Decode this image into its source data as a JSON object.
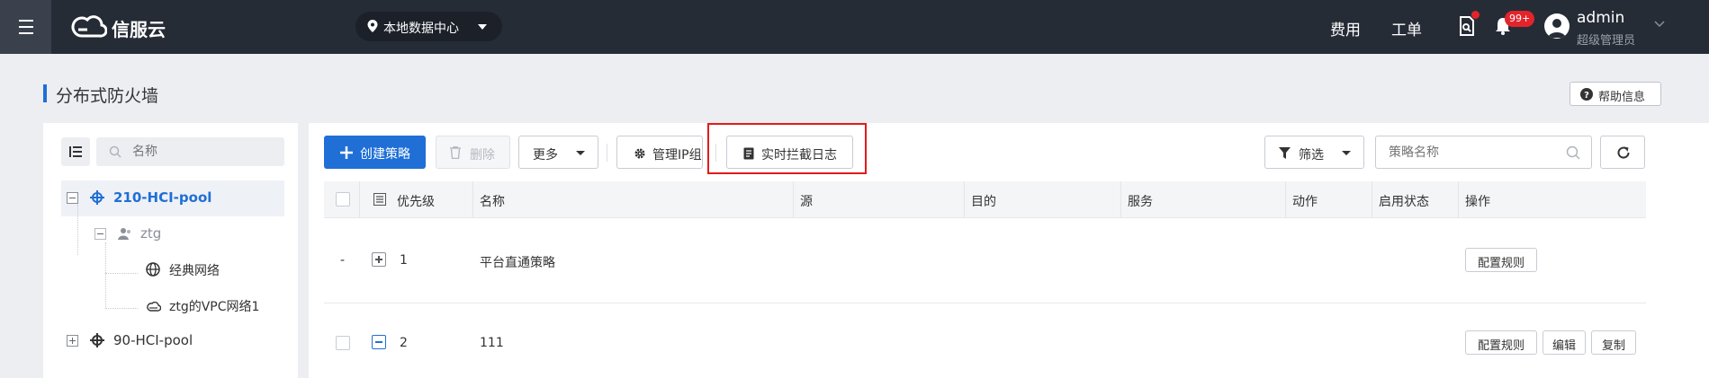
{
  "app": {
    "brand": "信服云",
    "datacenter": "本地数据中心",
    "links": {
      "billing": "费用",
      "tickets": "工单"
    },
    "notifications_badge": "99+",
    "user": {
      "name": "admin",
      "role": "超级管理员"
    }
  },
  "page": {
    "title": "分布式防火墙",
    "help_label": "帮助信息"
  },
  "tree": {
    "search_placeholder": "名称",
    "nodes": [
      {
        "label": "210-HCI-pool",
        "selected": true,
        "expanded": true
      },
      {
        "label": "ztg",
        "expanded": true
      },
      {
        "label": "经典网络"
      },
      {
        "label": "ztg的VPC网络1"
      },
      {
        "label": "90-HCI-pool",
        "expanded": false
      }
    ]
  },
  "toolbar": {
    "create": "创建策略",
    "delete": "删除",
    "more": "更多",
    "manage_ip_group": "管理IP组",
    "realtime_log": "实时拦截日志",
    "filter": "筛选",
    "search_placeholder": "策略名称"
  },
  "table": {
    "columns": [
      "优先级",
      "名称",
      "源",
      "目的",
      "服务",
      "动作",
      "启用状态",
      "操作"
    ],
    "rows": [
      {
        "check": "-",
        "priority": "1",
        "name": "平台直通策略",
        "actions": [
          "配置规则"
        ]
      },
      {
        "check": "",
        "priority": "2",
        "name": "111",
        "actions": [
          "配置规则",
          "编辑",
          "复制"
        ]
      }
    ]
  },
  "colors": {
    "topbar": "#262c36",
    "primary": "#1f6fd6",
    "highlight": "#e11a1a",
    "badge": "#e2242b"
  }
}
